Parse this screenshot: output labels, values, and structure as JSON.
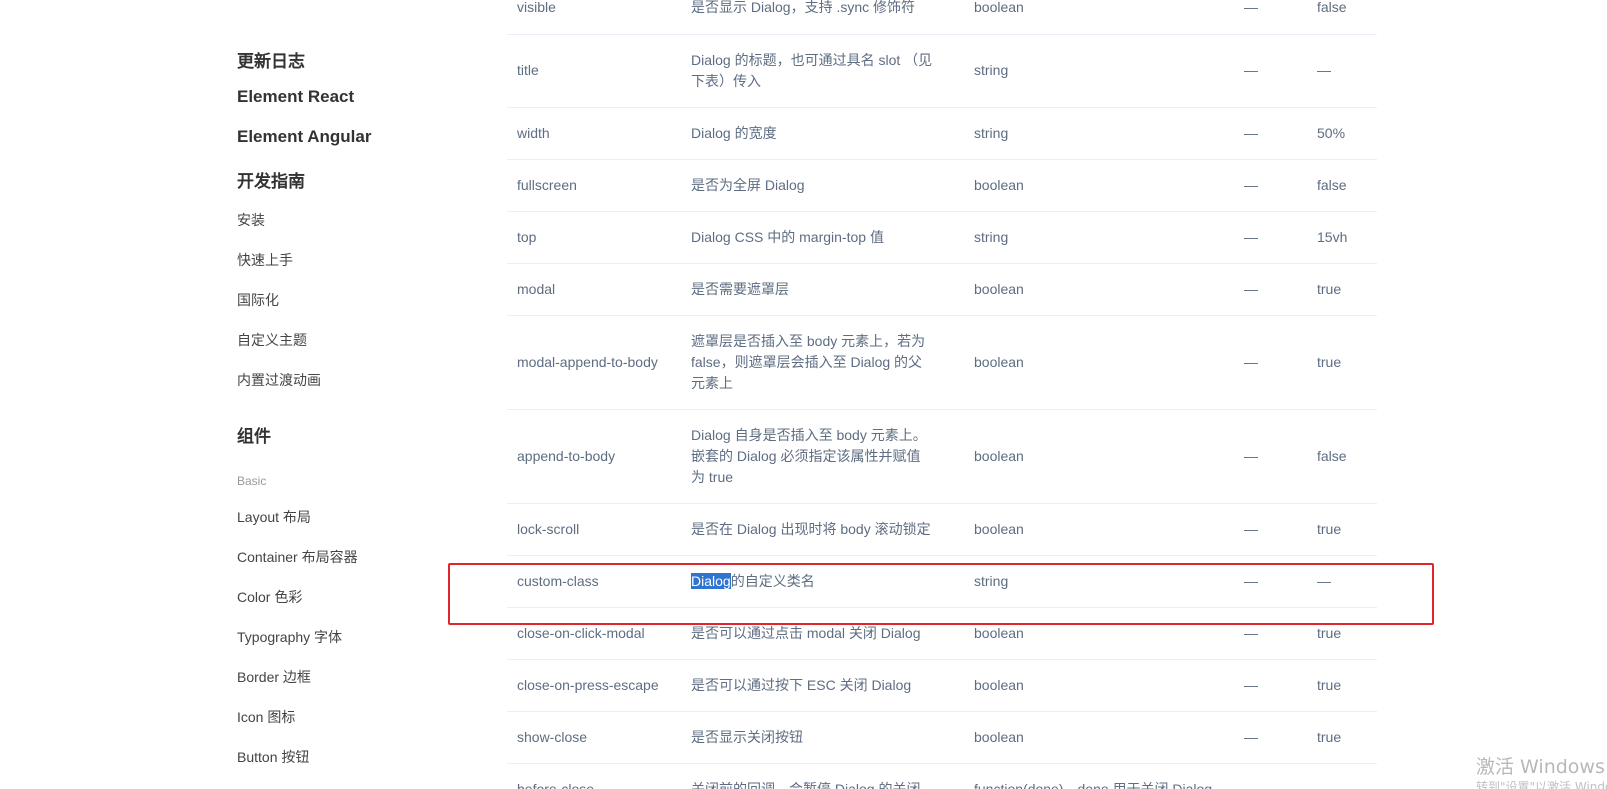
{
  "sidebar": {
    "headings": {
      "changelog": "更新日志",
      "element_react": "Element React",
      "element_angular": "Element Angular",
      "dev_guide": "开发指南",
      "components": "组件"
    },
    "guide_items": [
      "安装",
      "快速上手",
      "国际化",
      "自定义主题",
      "内置过渡动画"
    ],
    "group_basic": "Basic",
    "basic_items": [
      "Layout 布局",
      "Container 布局容器",
      "Color 色彩",
      "Typography 字体",
      "Border 边框",
      "Icon 图标",
      "Button 按钮"
    ]
  },
  "table": {
    "rows": [
      {
        "param": "visible",
        "desc": "是否显示 Dialog，支持 .sync 修饰符",
        "type": "boolean",
        "options": "—",
        "default": "false"
      },
      {
        "param": "title",
        "desc": "Dialog 的标题，也可通过具名 slot （见下表）传入",
        "type": "string",
        "options": "—",
        "default": "—"
      },
      {
        "param": "width",
        "desc": "Dialog 的宽度",
        "type": "string",
        "options": "—",
        "default": "50%"
      },
      {
        "param": "fullscreen",
        "desc": "是否为全屏 Dialog",
        "type": "boolean",
        "options": "—",
        "default": "false"
      },
      {
        "param": "top",
        "desc": "Dialog CSS 中的 margin-top 值",
        "type": "string",
        "options": "—",
        "default": "15vh"
      },
      {
        "param": "modal",
        "desc": "是否需要遮罩层",
        "type": "boolean",
        "options": "—",
        "default": "true"
      },
      {
        "param": "modal-append-to-body",
        "desc": "遮罩层是否插入至 body 元素上，若为 false，则遮罩层会插入至 Dialog 的父元素上",
        "type": "boolean",
        "options": "—",
        "default": "true"
      },
      {
        "param": "append-to-body",
        "desc": "Dialog 自身是否插入至 body 元素上。嵌套的 Dialog 必须指定该属性并赋值为 true",
        "type": "boolean",
        "options": "—",
        "default": "false"
      },
      {
        "param": "lock-scroll",
        "desc": "是否在 Dialog 出现时将 body 滚动锁定",
        "type": "boolean",
        "options": "—",
        "default": "true"
      },
      {
        "param": "custom-class",
        "desc_highlight": "Dialog",
        "desc_rest": "的自定义类名",
        "type": "string",
        "options": "—",
        "default": "—"
      },
      {
        "param": "close-on-click-modal",
        "desc": "是否可以通过点击 modal 关闭 Dialog",
        "type": "boolean",
        "options": "—",
        "default": "true"
      },
      {
        "param": "close-on-press-escape",
        "desc": "是否可以通过按下 ESC 关闭 Dialog",
        "type": "boolean",
        "options": "—",
        "default": "true"
      },
      {
        "param": "show-close",
        "desc": "是否显示关闭按钮",
        "type": "boolean",
        "options": "—",
        "default": "true"
      },
      {
        "param": "before-close",
        "desc": "关闭前的回调，会暂停 Dialog 的关闭",
        "type": "function(done)，done 用于关闭 Dialog",
        "options": "—",
        "default": "—"
      }
    ]
  },
  "annotation": {
    "box_color": "#e0262b",
    "selection_color": "#2f74d0"
  },
  "watermark": {
    "line1": "激活 Windows",
    "line2": "转到\"设置\"以激活 Windows。"
  }
}
